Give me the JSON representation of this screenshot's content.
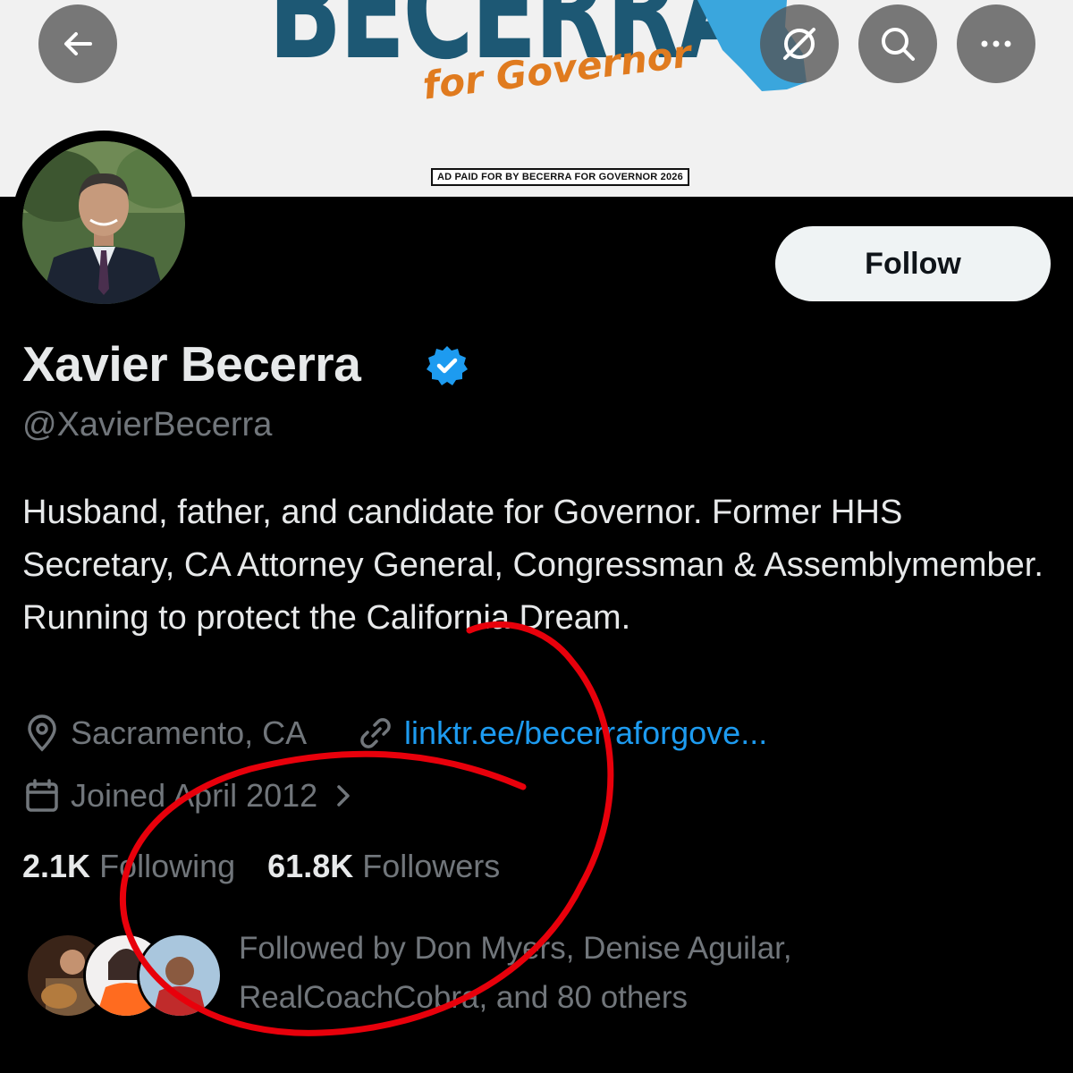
{
  "banner": {
    "title": "BECERRA",
    "subtitle": "for Governor",
    "disclaimer": "AD PAID FOR BY BECERRA FOR GOVERNOR 2026"
  },
  "nav": {
    "back_icon": "arrow-left-icon",
    "grok_icon": "grok-icon",
    "search_icon": "search-icon",
    "more_icon": "more-icon"
  },
  "profile": {
    "name": "Xavier Becerra",
    "handle": "@XavierBecerra",
    "bio": "Husband, father, and candidate for Governor. Former HHS Secretary, CA Attorney General, Congressman & Assemblymember. Running to protect the California Dream.",
    "location": "Sacramento, CA",
    "website": "linktr.ee/becerraforgove...",
    "joined": "Joined April 2012",
    "following_count": "2.1K",
    "following_label": "Following",
    "followers_count": "61.8K",
    "followers_label": "Followers",
    "followed_by": "Followed by Don Myers, Denise Aguilar, RealCoachCobra, and 80 others"
  },
  "follow_button": {
    "label": "Follow"
  },
  "colors": {
    "background": "#000000",
    "accent_blue": "#1d9bf0",
    "muted_text": "#71767b",
    "banner_navy": "#1d5874",
    "banner_orange": "#e07b1f",
    "annotation_red": "#e8000b"
  }
}
